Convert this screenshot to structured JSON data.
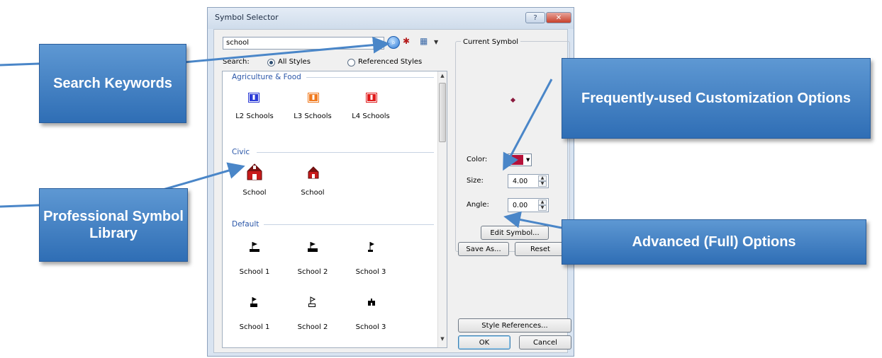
{
  "dialog": {
    "title": "Symbol Selector",
    "help_glyph": "?",
    "close_glyph": "✕",
    "search": {
      "value": "school",
      "label": "Search:",
      "scope_all": "All Styles",
      "scope_referenced": "Referenced Styles",
      "selected_scope": "All Styles"
    },
    "groups": [
      {
        "name": "Agriculture & Food",
        "symbols": [
          "L2 Schools",
          "L3 Schools",
          "L4 Schools"
        ]
      },
      {
        "name": "Civic",
        "symbols": [
          "School",
          "School"
        ]
      },
      {
        "name": "Default",
        "symbols": [
          "School 1",
          "School 2",
          "School 3",
          "School 1",
          "School 2",
          "School 3"
        ]
      }
    ],
    "current_symbol": {
      "title": "Current Symbol",
      "color_label": "Color:",
      "color": "#b5123a",
      "size_label": "Size:",
      "size_value": "4.00",
      "angle_label": "Angle:",
      "angle_value": "0.00"
    },
    "buttons": {
      "edit_symbol": "Edit Symbol...",
      "save_as": "Save As...",
      "reset": "Reset",
      "style_references": "Style References...",
      "ok": "OK",
      "cancel": "Cancel"
    }
  },
  "annotations": {
    "search_keywords": "Search Keywords",
    "frequently_used": "Frequently-used Customization Options",
    "symbol_library": "Professional Symbol Library",
    "advanced_options": "Advanced (Full) Options"
  },
  "colors": {
    "callout_fill": "#3f7fc2",
    "arrow": "#4a86c8",
    "group_heading": "#2a56a8"
  }
}
